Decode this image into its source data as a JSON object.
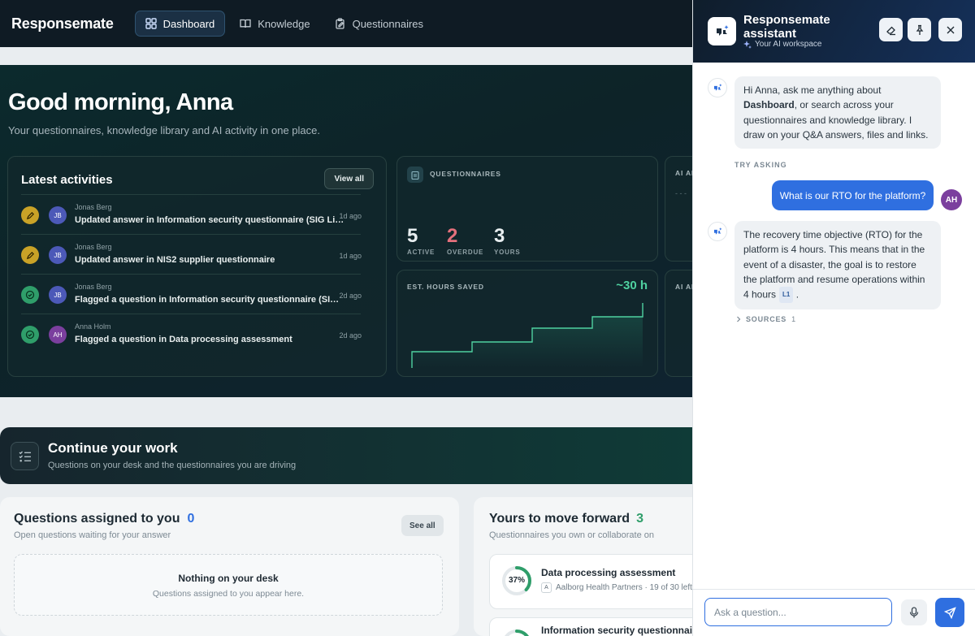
{
  "app": {
    "brand": "Responsemate"
  },
  "nav": {
    "tabs": [
      {
        "label": "Dashboard",
        "icon": "grid-icon",
        "active": true
      },
      {
        "label": "Knowledge",
        "icon": "book-icon",
        "active": false
      },
      {
        "label": "Questionnaires",
        "icon": "clipboard-edit-icon",
        "active": false
      }
    ]
  },
  "hero": {
    "greeting": "Good morning, Anna",
    "subtitle": "Your questionnaires, knowledge library and AI activity in one place."
  },
  "activities": {
    "title": "Latest activities",
    "view_all": "View all",
    "items": [
      {
        "kind": "pencil-icon",
        "kind_color": "#c9a227",
        "initials": "JB",
        "avatar_color": "#4c59b8",
        "name": "Jonas Berg",
        "text": "Updated answer in Information security questionnaire (SIG Lite)",
        "time": "1d ago"
      },
      {
        "kind": "pencil-icon",
        "kind_color": "#c9a227",
        "initials": "JB",
        "avatar_color": "#4c59b8",
        "name": "Jonas Berg",
        "text": "Updated answer in NIS2 supplier questionnaire",
        "time": "1d ago"
      },
      {
        "kind": "check-circle-icon",
        "kind_color": "#2f9e6a",
        "initials": "JB",
        "avatar_color": "#4c59b8",
        "name": "Jonas Berg",
        "text": "Flagged a question in Information security questionnaire (SIG Lite)",
        "time": "2d ago"
      },
      {
        "kind": "check-circle-icon",
        "kind_color": "#2f9e6a",
        "initials": "AH",
        "avatar_color": "#7b3f9e",
        "name": "Anna Holm",
        "text": "Flagged a question in Data processing assessment",
        "time": "2d ago"
      }
    ]
  },
  "questionnaires": {
    "label": "QUESTIONNAIRES",
    "stats": [
      {
        "value": "5",
        "label": "ACTIVE",
        "color": "#e8eef0"
      },
      {
        "value": "2",
        "label": "OVERDUE",
        "color": "#e5707c"
      },
      {
        "value": "3",
        "label": "YOURS",
        "color": "#e8eef0"
      }
    ]
  },
  "hours": {
    "label": "EST. HOURS SAVED",
    "value": "~30 h",
    "accent": "#4fd1a0"
  },
  "side_cards": {
    "label_top": "AI AN",
    "label_bottom": "AI AN",
    "dash": "- - -"
  },
  "continue": {
    "title": "Continue your work",
    "subtitle": "Questions on your desk and the questionnaires you are driving"
  },
  "assigned": {
    "title": "Questions assigned to you",
    "count": "0",
    "subtitle": "Open questions waiting for your answer",
    "see_all": "See all",
    "empty_title": "Nothing on your desk",
    "empty_sub": "Questions assigned to you appear here."
  },
  "forward": {
    "title": "Yours to move forward",
    "count": "3",
    "subtitle": "Questionnaires you own or collaborate on",
    "items": [
      {
        "name": "Data processing assessment",
        "percent": "37%",
        "progress": 0.37,
        "org_initial": "A",
        "meta": "Aalborg Health Partners · 19 of 30 left"
      },
      {
        "name": "Information security questionnaire",
        "percent": "",
        "progress": 0.55
      }
    ]
  },
  "assistant": {
    "title": "Responsemate assistant",
    "subtitle": "Your AI workspace",
    "greeting_pre": "Hi Anna, ask me anything about ",
    "greeting_bold": "Dashboard",
    "greeting_post": ", or search across your questionnaires and knowledge library. I draw on your Q&A answers, files and links.",
    "try_asking": "TRY ASKING",
    "user_question": "What is our RTO for the platform?",
    "user_initials": "AH",
    "answer": "The recovery time objective (RTO) for the platform is 4 hours. This means that in the event of a disaster, the goal is to restore the platform and resume operations within 4 hours",
    "answer_tag": "L1",
    "sources_label": "SOURCES",
    "sources_count": "1",
    "input_placeholder": "Ask a question..."
  }
}
